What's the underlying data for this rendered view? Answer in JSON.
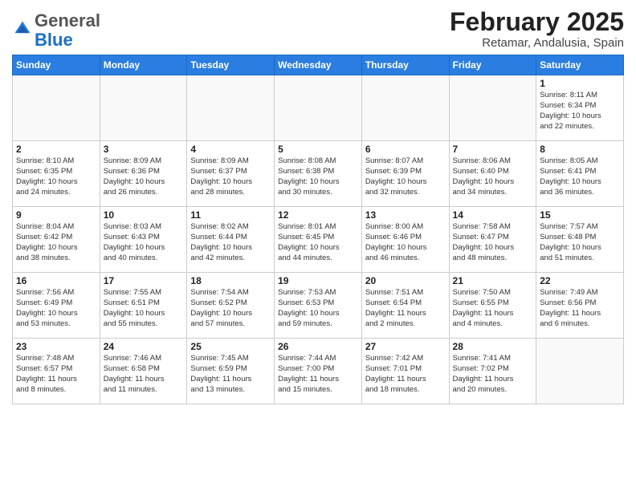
{
  "logo": {
    "general": "General",
    "blue": "Blue"
  },
  "header": {
    "month_year": "February 2025",
    "location": "Retamar, Andalusia, Spain"
  },
  "weekdays": [
    "Sunday",
    "Monday",
    "Tuesday",
    "Wednesday",
    "Thursday",
    "Friday",
    "Saturday"
  ],
  "days": [
    {
      "num": "",
      "info": ""
    },
    {
      "num": "",
      "info": ""
    },
    {
      "num": "",
      "info": ""
    },
    {
      "num": "",
      "info": ""
    },
    {
      "num": "",
      "info": ""
    },
    {
      "num": "",
      "info": ""
    },
    {
      "num": "1",
      "info": "Sunrise: 8:11 AM\nSunset: 6:34 PM\nDaylight: 10 hours\nand 22 minutes."
    },
    {
      "num": "2",
      "info": "Sunrise: 8:10 AM\nSunset: 6:35 PM\nDaylight: 10 hours\nand 24 minutes."
    },
    {
      "num": "3",
      "info": "Sunrise: 8:09 AM\nSunset: 6:36 PM\nDaylight: 10 hours\nand 26 minutes."
    },
    {
      "num": "4",
      "info": "Sunrise: 8:09 AM\nSunset: 6:37 PM\nDaylight: 10 hours\nand 28 minutes."
    },
    {
      "num": "5",
      "info": "Sunrise: 8:08 AM\nSunset: 6:38 PM\nDaylight: 10 hours\nand 30 minutes."
    },
    {
      "num": "6",
      "info": "Sunrise: 8:07 AM\nSunset: 6:39 PM\nDaylight: 10 hours\nand 32 minutes."
    },
    {
      "num": "7",
      "info": "Sunrise: 8:06 AM\nSunset: 6:40 PM\nDaylight: 10 hours\nand 34 minutes."
    },
    {
      "num": "8",
      "info": "Sunrise: 8:05 AM\nSunset: 6:41 PM\nDaylight: 10 hours\nand 36 minutes."
    },
    {
      "num": "9",
      "info": "Sunrise: 8:04 AM\nSunset: 6:42 PM\nDaylight: 10 hours\nand 38 minutes."
    },
    {
      "num": "10",
      "info": "Sunrise: 8:03 AM\nSunset: 6:43 PM\nDaylight: 10 hours\nand 40 minutes."
    },
    {
      "num": "11",
      "info": "Sunrise: 8:02 AM\nSunset: 6:44 PM\nDaylight: 10 hours\nand 42 minutes."
    },
    {
      "num": "12",
      "info": "Sunrise: 8:01 AM\nSunset: 6:45 PM\nDaylight: 10 hours\nand 44 minutes."
    },
    {
      "num": "13",
      "info": "Sunrise: 8:00 AM\nSunset: 6:46 PM\nDaylight: 10 hours\nand 46 minutes."
    },
    {
      "num": "14",
      "info": "Sunrise: 7:58 AM\nSunset: 6:47 PM\nDaylight: 10 hours\nand 48 minutes."
    },
    {
      "num": "15",
      "info": "Sunrise: 7:57 AM\nSunset: 6:48 PM\nDaylight: 10 hours\nand 51 minutes."
    },
    {
      "num": "16",
      "info": "Sunrise: 7:56 AM\nSunset: 6:49 PM\nDaylight: 10 hours\nand 53 minutes."
    },
    {
      "num": "17",
      "info": "Sunrise: 7:55 AM\nSunset: 6:51 PM\nDaylight: 10 hours\nand 55 minutes."
    },
    {
      "num": "18",
      "info": "Sunrise: 7:54 AM\nSunset: 6:52 PM\nDaylight: 10 hours\nand 57 minutes."
    },
    {
      "num": "19",
      "info": "Sunrise: 7:53 AM\nSunset: 6:53 PM\nDaylight: 10 hours\nand 59 minutes."
    },
    {
      "num": "20",
      "info": "Sunrise: 7:51 AM\nSunset: 6:54 PM\nDaylight: 11 hours\nand 2 minutes."
    },
    {
      "num": "21",
      "info": "Sunrise: 7:50 AM\nSunset: 6:55 PM\nDaylight: 11 hours\nand 4 minutes."
    },
    {
      "num": "22",
      "info": "Sunrise: 7:49 AM\nSunset: 6:56 PM\nDaylight: 11 hours\nand 6 minutes."
    },
    {
      "num": "23",
      "info": "Sunrise: 7:48 AM\nSunset: 6:57 PM\nDaylight: 11 hours\nand 8 minutes."
    },
    {
      "num": "24",
      "info": "Sunrise: 7:46 AM\nSunset: 6:58 PM\nDaylight: 11 hours\nand 11 minutes."
    },
    {
      "num": "25",
      "info": "Sunrise: 7:45 AM\nSunset: 6:59 PM\nDaylight: 11 hours\nand 13 minutes."
    },
    {
      "num": "26",
      "info": "Sunrise: 7:44 AM\nSunset: 7:00 PM\nDaylight: 11 hours\nand 15 minutes."
    },
    {
      "num": "27",
      "info": "Sunrise: 7:42 AM\nSunset: 7:01 PM\nDaylight: 11 hours\nand 18 minutes."
    },
    {
      "num": "28",
      "info": "Sunrise: 7:41 AM\nSunset: 7:02 PM\nDaylight: 11 hours\nand 20 minutes."
    },
    {
      "num": "",
      "info": ""
    }
  ]
}
